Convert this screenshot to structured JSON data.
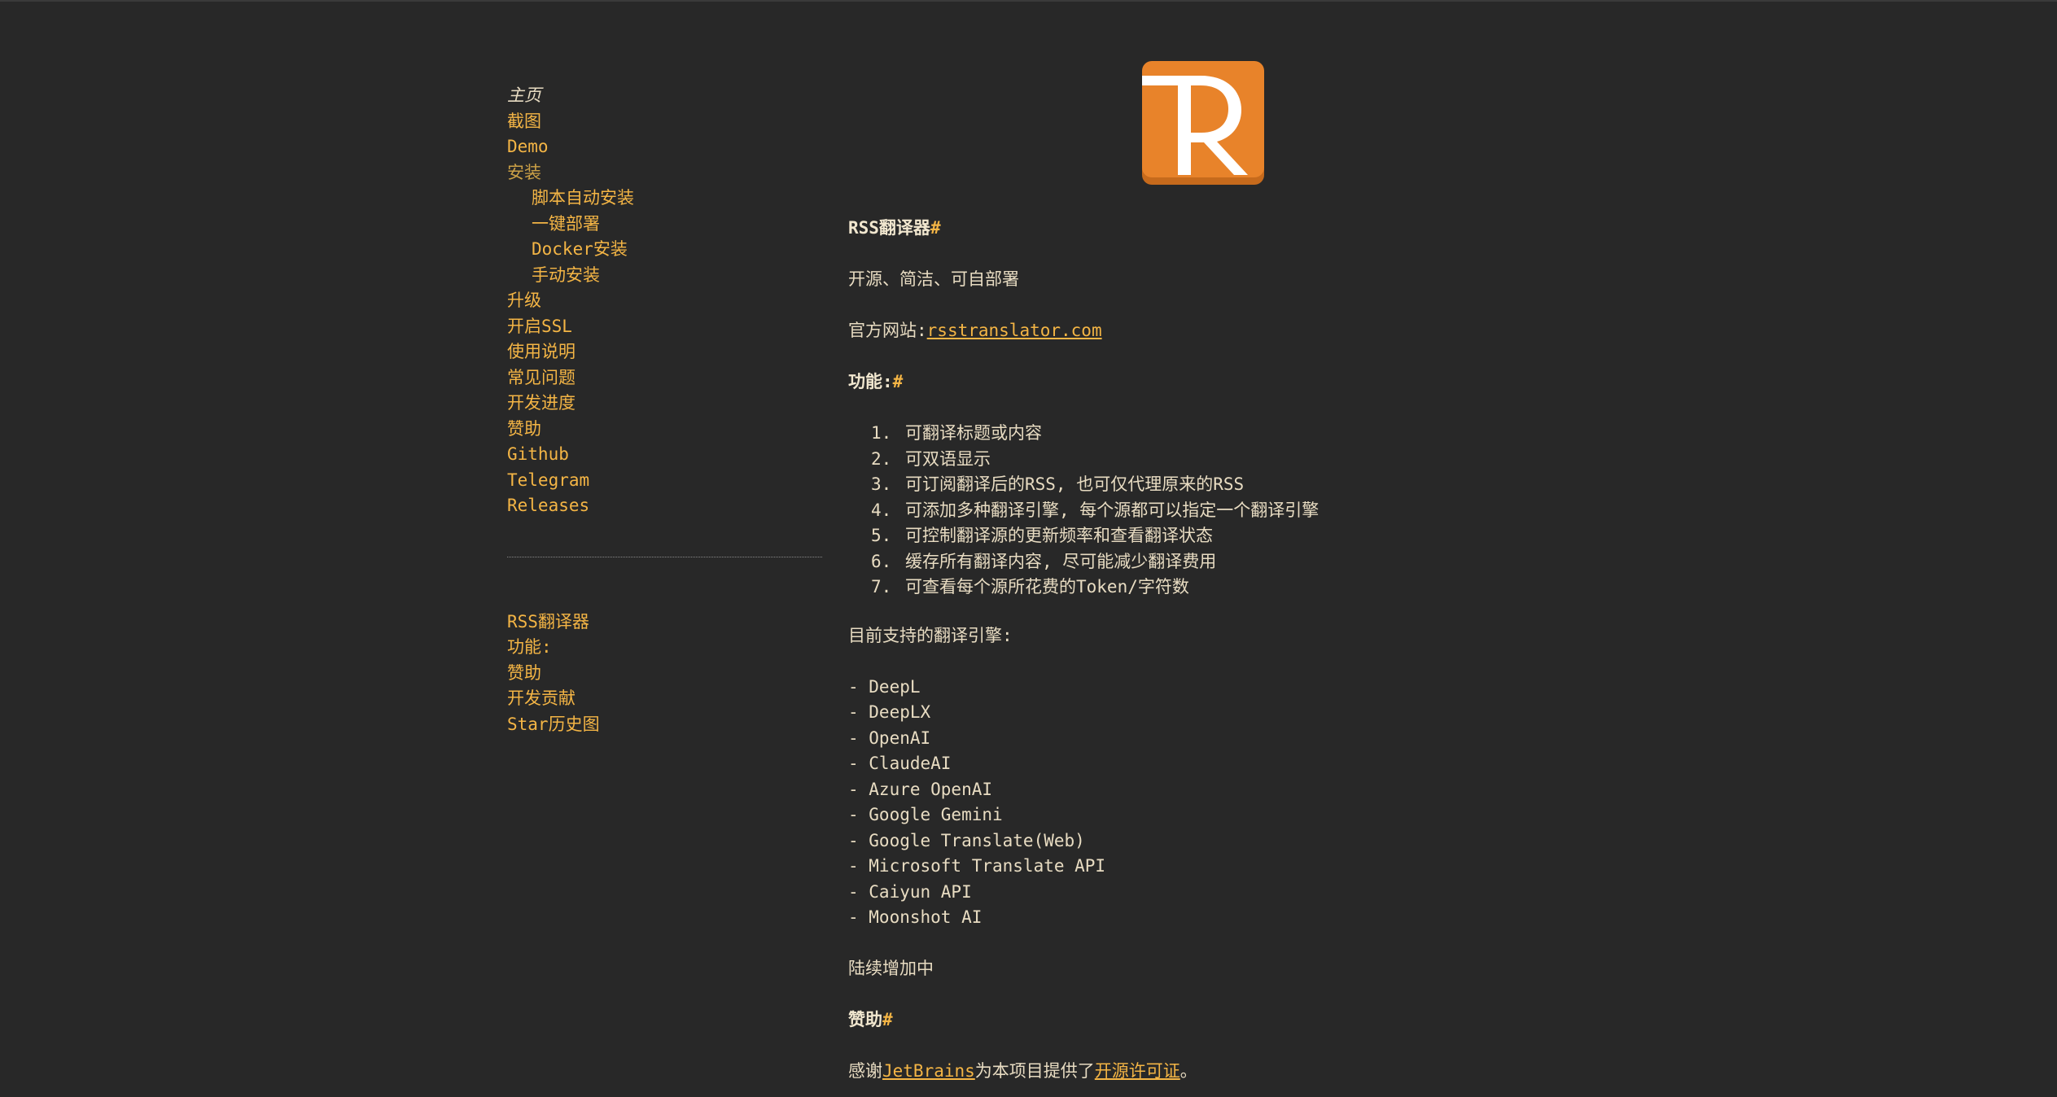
{
  "sidebar": {
    "nav": [
      {
        "label": "主页"
      },
      {
        "label": "截图"
      },
      {
        "label": "Demo"
      },
      {
        "label": "安装"
      },
      {
        "label": "脚本自动安装"
      },
      {
        "label": "一键部署"
      },
      {
        "label": "Docker安装"
      },
      {
        "label": "手动安装"
      },
      {
        "label": "升级"
      },
      {
        "label": "开启SSL"
      },
      {
        "label": "使用说明"
      },
      {
        "label": "常见问题"
      },
      {
        "label": "开发进度"
      },
      {
        "label": "赞助"
      },
      {
        "label": "Github"
      },
      {
        "label": "Telegram"
      },
      {
        "label": "Releases"
      }
    ],
    "toc": [
      {
        "label": "RSS翻译器"
      },
      {
        "label": "功能:"
      },
      {
        "label": "赞助"
      },
      {
        "label": "开发贡献"
      },
      {
        "label": "Star历史图"
      }
    ]
  },
  "main": {
    "logo_icon": "rss-translator-logo-icon",
    "title": "RSS翻译器",
    "anchor": "#",
    "tagline": "开源、简洁、可自部署",
    "website_prefix": "官方网站:",
    "website_link": "rsstranslator.com",
    "features_heading": "功能:",
    "features": [
      {
        "num": "1.",
        "text": "可翻译标题或内容"
      },
      {
        "num": "2.",
        "text": "可双语显示"
      },
      {
        "num": "3.",
        "text": "可订阅翻译后的RSS, 也可仅代理原来的RSS"
      },
      {
        "num": "4.",
        "text": "可添加多种翻译引擎, 每个源都可以指定一个翻译引擎"
      },
      {
        "num": "5.",
        "text": "可控制翻译源的更新频率和查看翻译状态"
      },
      {
        "num": "6.",
        "text": "缓存所有翻译内容, 尽可能减少翻译费用"
      },
      {
        "num": "7.",
        "text": "可查看每个源所花费的Token/字符数"
      }
    ],
    "engines_intro": "目前支持的翻译引擎:",
    "engines": [
      "- DeepL",
      "- DeepLX",
      "- OpenAI",
      "- ClaudeAI",
      "- Azure OpenAI",
      "- Google Gemini",
      "- Google Translate(Web)",
      "- Microsoft Translate API",
      "- Caiyun API",
      "- Moonshot AI"
    ],
    "more": "陆续增加中",
    "sponsor_heading": "赞助",
    "thanks_prefix": "感谢",
    "thanks_link1": "JetBrains",
    "thanks_middle": "为本项目提供了",
    "thanks_link2": "开源许可证",
    "thanks_suffix": "。"
  },
  "colors": {
    "background": "#282828",
    "text": "#e8dcc2",
    "accent": "#f4b545",
    "logo": "#e8832a"
  }
}
